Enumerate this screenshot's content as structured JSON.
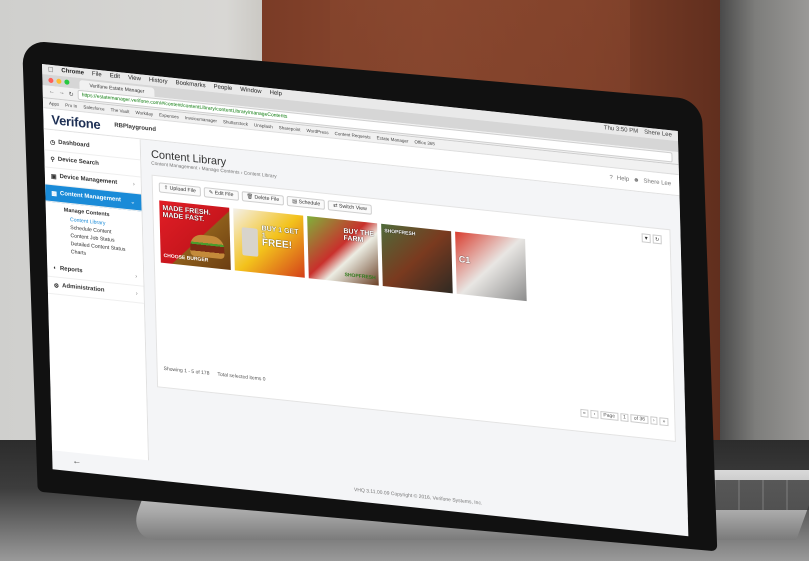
{
  "menubar": {
    "app": "Chrome",
    "items": [
      "File",
      "Edit",
      "View",
      "History",
      "Bookmarks",
      "People",
      "Window",
      "Help"
    ],
    "clock": "Thu 3:50 PM",
    "user": "Shere Lee"
  },
  "tab": {
    "title": "Verifone Estate Manager"
  },
  "url": "https://estatemanager.verifone.com/#/content/contentLibrary/contentLibrary/manageContents",
  "bookmarks": [
    "Apps",
    "Pro In",
    "Salesforce",
    "The Vault",
    "Workday",
    "Expenses",
    "Invoicemanager",
    "Shutterstock",
    "Unsplash",
    "Sharepoint",
    "WordPress",
    "Content Requests",
    "Estate Manager",
    "Office 365"
  ],
  "header": {
    "logo": "Verifone",
    "store": "RBPlayground",
    "help": "Help",
    "user": "Shere Lee"
  },
  "sidebar": {
    "items": [
      {
        "label": "Dashboard"
      },
      {
        "label": "Device Search"
      },
      {
        "label": "Device Management"
      },
      {
        "label": "Content Management"
      },
      {
        "label": "Reports"
      },
      {
        "label": "Administration"
      }
    ],
    "submenu_title": "Manage Contents",
    "subitems": [
      "Content Library",
      "Schedule Content",
      "Content Job Status",
      "Detailed Content Status",
      "Charts"
    ]
  },
  "main": {
    "title": "Content Library",
    "breadcrumb": [
      "Content Management",
      "Manage Contents",
      "Content Library"
    ],
    "toolbar": [
      "Upload File",
      "Edit File",
      "Delete File",
      "Schedule",
      "Switch View"
    ],
    "thumbs": [
      {
        "line1": "MADE FRESH.",
        "line2": "MADE FAST.",
        "line3": "CHOOSE BURGER"
      },
      {
        "line1": "BUY 1 GET 1",
        "line2": "FREE!",
        "line3": ""
      },
      {
        "line1": "BUY THE",
        "line2": "FARM",
        "line3": "SHOPFRESH"
      },
      {
        "line1": "SHOPFRESH",
        "line2": "",
        "line3": ""
      },
      {
        "line1": "C1",
        "line2": "",
        "line3": ""
      }
    ],
    "showing": "Showing 1 - 5 of 178",
    "selected": "Total selected items 0",
    "page_label": "Page",
    "page_value": "1",
    "page_of": "of 36"
  },
  "footer": "VHQ 3.11.00.09 Copyright © 2016, Verifone Systems, Inc.",
  "colors": {
    "accent": "#1a8bd8",
    "logo": "#1d2f54"
  }
}
